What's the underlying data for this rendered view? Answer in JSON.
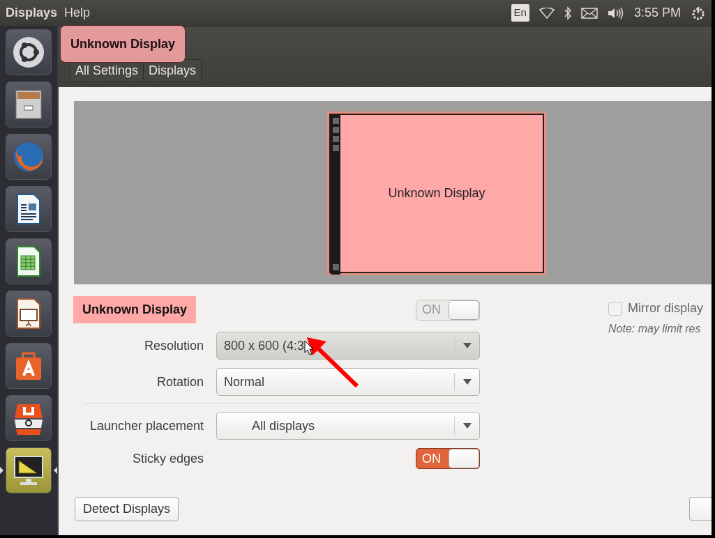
{
  "top_panel": {
    "menus": [
      "Displays",
      "Help"
    ],
    "keyboard_layout": "En",
    "clock": "3:55 PM"
  },
  "launcher": {
    "items": [
      {
        "kind": "ubuntu",
        "selected": false
      },
      {
        "kind": "files",
        "selected": false
      },
      {
        "kind": "browser",
        "selected": false
      },
      {
        "kind": "writer",
        "selected": false
      },
      {
        "kind": "calc",
        "selected": false
      },
      {
        "kind": "impress",
        "selected": false
      },
      {
        "kind": "software",
        "selected": false
      },
      {
        "kind": "stack",
        "selected": false
      },
      {
        "kind": "displays",
        "selected": true
      }
    ]
  },
  "overlay_label": "Unknown Display",
  "breadcrumb": [
    "All Settings",
    "Displays"
  ],
  "arrangement": {
    "monitors": [
      {
        "label": "Unknown Display"
      }
    ]
  },
  "display_name": "Unknown Display",
  "display_toggle": {
    "label": "ON",
    "on": true,
    "disabled": true
  },
  "mirror": {
    "label": "Mirror display",
    "checked": false,
    "note": "Note: may limit res"
  },
  "settings": [
    {
      "kind": "combo",
      "label": "Resolution",
      "value": "800 x 600 (4:3",
      "hovered": true
    },
    {
      "kind": "combo",
      "label": "Rotation",
      "value": "Normal",
      "hovered": false
    },
    {
      "kind": "divider"
    },
    {
      "kind": "combo",
      "label": "Launcher placement",
      "value": "All displays",
      "hovered": false,
      "centered": true
    },
    {
      "kind": "toggle",
      "label": "Sticky edges",
      "value": "ON",
      "on": true,
      "disabled": false
    }
  ],
  "buttons": [
    "Detect Displays"
  ]
}
